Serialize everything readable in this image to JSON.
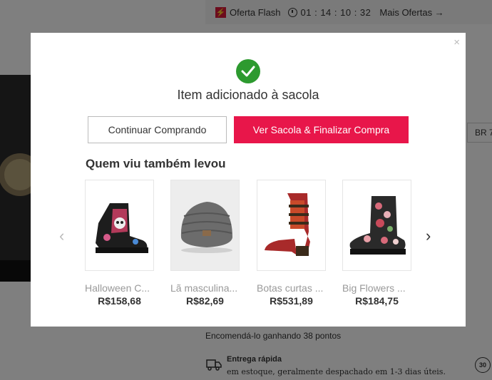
{
  "background": {
    "flash_label": "Oferta Flash",
    "timer": "01 : 14 : 10 : 32",
    "more_deals": "Mais Ofertas →",
    "size_tag": "BR 7",
    "points_text": "Encomendá-lo ganhando 38 pontos",
    "delivery_title": "Entrega rápida",
    "delivery_sub": "em estoque, geralmente despachado em 1-3 dias úteis.",
    "return_badge": "30"
  },
  "modal": {
    "close": "×",
    "title": "Item adicionado à sacola",
    "continue_label": "Continuar Comprando",
    "checkout_label": "Ver Sacola & Finalizar Compra",
    "rec_title": "Quem viu também levou",
    "prev_arrow": "‹",
    "next_arrow": "›",
    "products": [
      {
        "name": "Halloween Colorful Skull Boots",
        "display_name": "Halloween C...",
        "price": "R$158,68",
        "icon": "skull-boot-icon"
      },
      {
        "name": "Lã masculina gorro",
        "display_name": "Lã masculina...",
        "price": "R$82,69",
        "icon": "beanie-icon"
      },
      {
        "name": "Botas curtas florais",
        "display_name": "Botas curtas ...",
        "price": "R$531,89",
        "icon": "red-boot-icon"
      },
      {
        "name": "Big Flowers Boots",
        "display_name": "Big Flowers ...",
        "price": "R$184,75",
        "icon": "floral-boot-icon"
      }
    ]
  },
  "colors": {
    "accent": "#e8164a",
    "success": "#2d9a2f",
    "overlay": "rgba(0,0,0,0.5)"
  }
}
